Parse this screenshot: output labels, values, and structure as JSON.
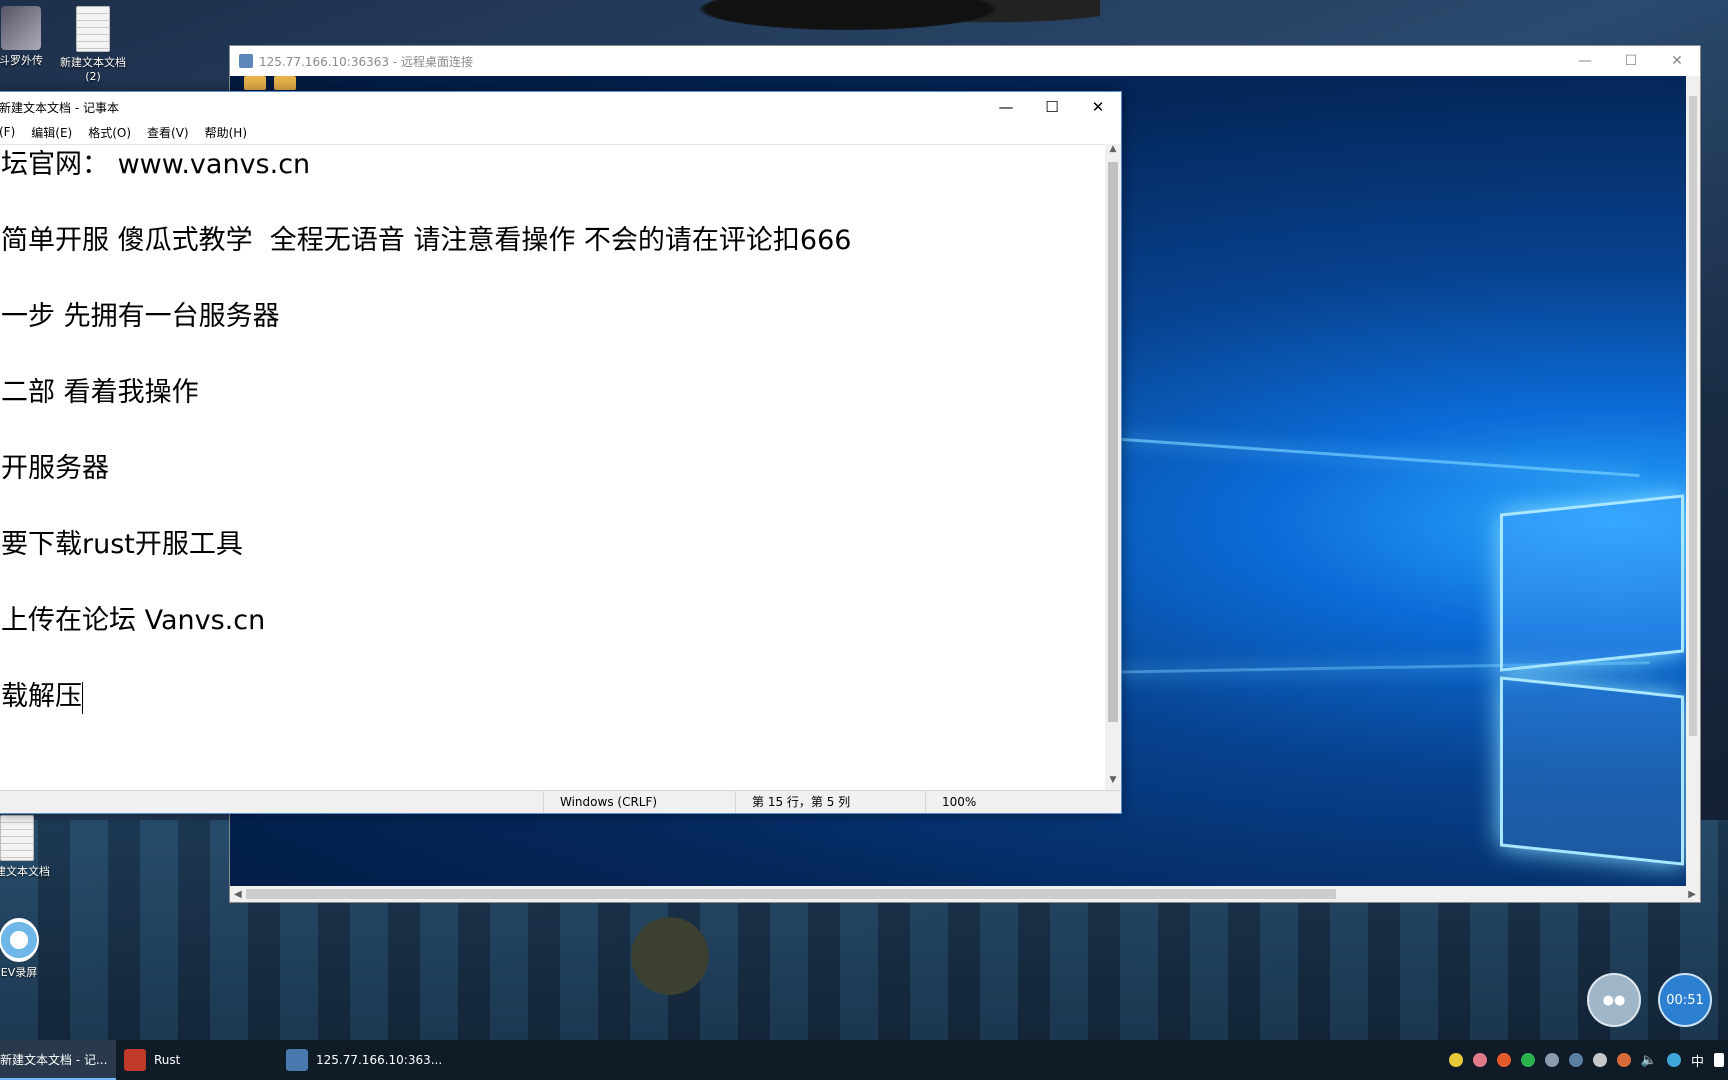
{
  "desktop": {
    "icons": [
      {
        "label": "斗罗外传"
      },
      {
        "label": "新建文本文档",
        "sub": "(2)"
      },
      {
        "label": "新建文本文档"
      },
      {
        "label": "EV录屏"
      }
    ]
  },
  "rdp": {
    "title": "125.77.166.10:36363 - 远程桌面连接"
  },
  "notepad": {
    "title": "新建文本文档 - 记事本",
    "menu": [
      "(F)",
      "编辑(E)",
      "格式(O)",
      "查看(V)",
      "帮助(H)"
    ],
    "lines": [
      "坛官网： www.vanvs.cn",
      "简单开服 傻瓜式教学  全程无语音 请注意看操作 不会的请在评论扣666",
      "一步 先拥有一台服务器",
      "二部 看着我操作",
      "开服务器",
      "要下载rust开服工具",
      "上传在论坛 Vanvs.cn",
      "载解压"
    ],
    "status": {
      "encoding": "Windows (CRLF)",
      "position": "第 15 行，第 5 列",
      "zoom": "100%"
    }
  },
  "taskbar": {
    "items": [
      {
        "label": "新建文本文档 - 记..."
      },
      {
        "label": "Rust"
      },
      {
        "label": "125.77.166.10:363..."
      }
    ],
    "ime": "中"
  },
  "timer": "00:51",
  "colors": {
    "taskbar": "#101b28",
    "accent": "#78b4ff",
    "rust_red": "#c0392b"
  }
}
